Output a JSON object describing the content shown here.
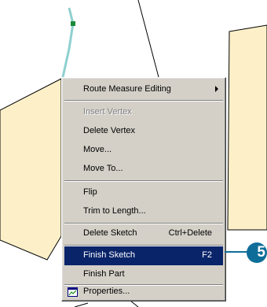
{
  "menu": {
    "items": [
      {
        "label": "Route Measure Editing",
        "submenu": true
      },
      {
        "label": "Insert Vertex",
        "disabled": true
      },
      {
        "label": "Delete Vertex"
      },
      {
        "label": "Move..."
      },
      {
        "label": "Move To..."
      },
      {
        "label": "Flip"
      },
      {
        "label": "Trim to Length..."
      },
      {
        "label": "Delete Sketch",
        "shortcut": "Ctrl+Delete"
      },
      {
        "label": "Finish Sketch",
        "shortcut": "F2",
        "highlighted": true
      },
      {
        "label": "Finish Part"
      },
      {
        "label": "Properties...",
        "icon": "properties-icon"
      }
    ]
  },
  "callout": {
    "number": "5"
  },
  "colors": {
    "menu_background": "#d4d0c8",
    "highlight": "#0a246a",
    "parcel_fill": "#fdf0c8",
    "sketch_line": "#8fd0d0",
    "vertex": "#1a8a3a",
    "callout": "#0f6e99"
  }
}
